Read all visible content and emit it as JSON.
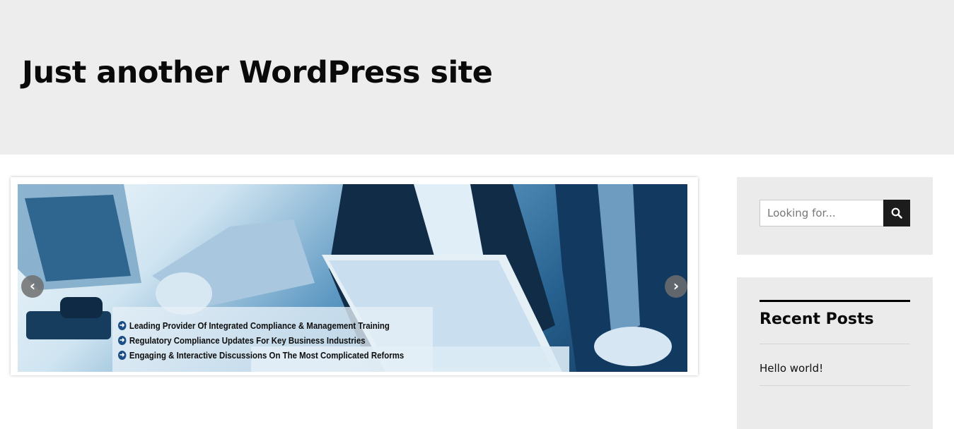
{
  "header": {
    "site_title": "Just another WordPress site"
  },
  "slider": {
    "captions": [
      "Leading Provider Of Integrated Compliance & Management Training",
      "Regulatory Compliance Updates For Key Business Industries",
      "Engaging & Interactive Discussions On The Most Complicated Reforms"
    ],
    "prev_icon": "chevron-left-icon",
    "next_icon": "chevron-right-icon",
    "bullet_icon": "arrow-circle-right-icon"
  },
  "sidebar": {
    "search": {
      "placeholder": "Looking for...",
      "button_icon": "search-icon"
    },
    "recent_posts": {
      "title": "Recent Posts",
      "items": [
        {
          "label": "Hello world!"
        }
      ]
    }
  },
  "colors": {
    "header_bg": "#ededed",
    "widget_bg": "#ebebeb",
    "search_button": "#1c1c1c",
    "caption_bullet": "#1b4e86"
  }
}
